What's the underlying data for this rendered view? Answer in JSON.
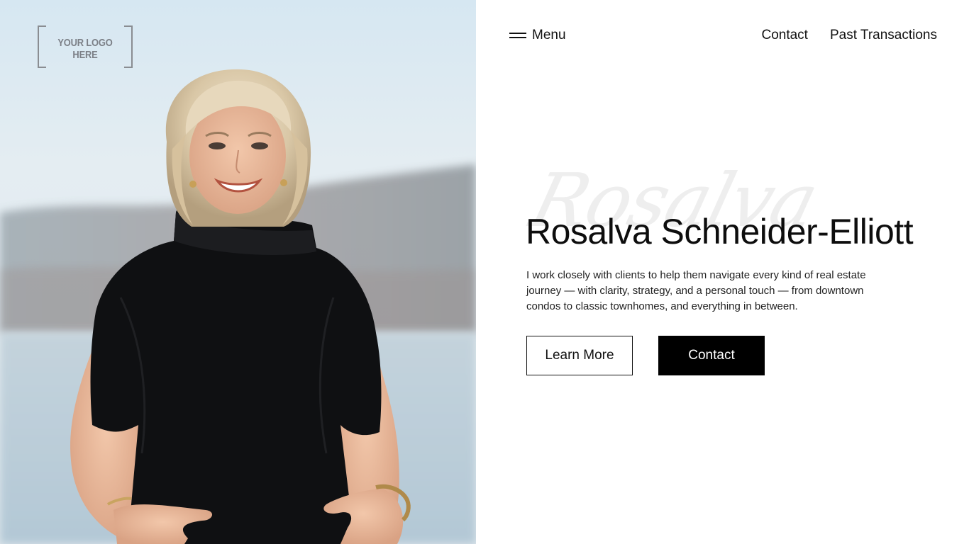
{
  "logo": {
    "text": "YOUR LOGO HERE"
  },
  "nav": {
    "menu_label": "Menu",
    "links": [
      "Contact",
      "Past Transactions"
    ]
  },
  "hero": {
    "script_name": "Rosalva",
    "name": "Rosalva Schneider-Elliott",
    "description": "I work closely with clients to help them navigate every kind of real estate journey — with clarity, strategy, and a personal touch — from downtown condos to classic townhomes, and everything in between.",
    "learn_more_label": "Learn More",
    "contact_label": "Contact"
  },
  "colors": {
    "primary": "#000000",
    "background": "#ffffff",
    "text": "#111111",
    "watermark": "#eeeeee"
  },
  "icons": {
    "menu": "hamburger-icon"
  }
}
